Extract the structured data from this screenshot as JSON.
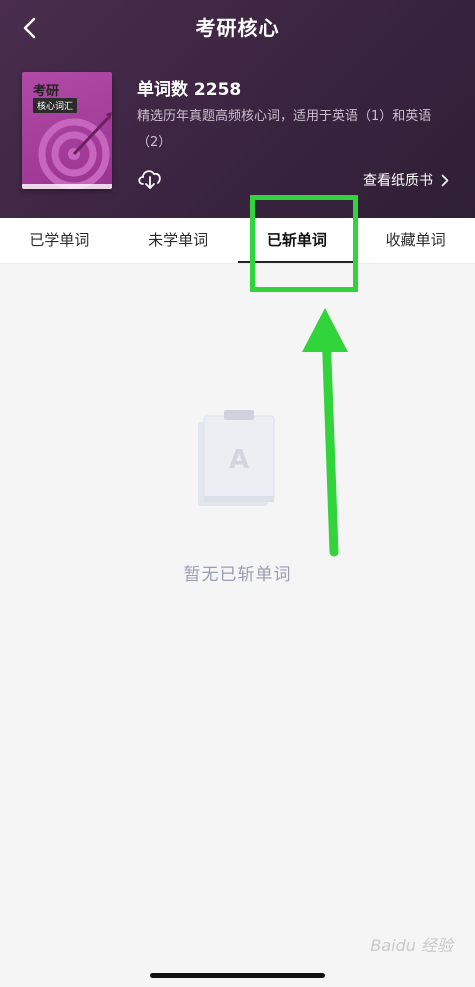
{
  "header": {
    "title": "考研核心",
    "back_icon": "chevron-left-icon"
  },
  "book": {
    "cover_title": "考研",
    "cover_tag": "核心词汇",
    "word_count": "单词数 2258",
    "description": "精选历年真题高频核心词，适用于英语（1）和英语（2）",
    "download_icon": "cloud-download-icon",
    "paper_book_link": "查看纸质书"
  },
  "tabs": [
    {
      "label": "已学单词",
      "active": false
    },
    {
      "label": "未学单词",
      "active": false
    },
    {
      "label": "已斩单词",
      "active": true
    },
    {
      "label": "收藏单词",
      "active": false
    }
  ],
  "empty_state": {
    "icon": "empty-notebook-icon",
    "text": "暂无已斩单词"
  },
  "annotation": {
    "highlight_color": "#31d43a"
  },
  "watermark": "Baidu 经验",
  "colors": {
    "header_bg": "#3a2440",
    "cover": "#a83c9f",
    "page_bg": "#f5f5f6",
    "empty_text": "#9a9db0"
  }
}
